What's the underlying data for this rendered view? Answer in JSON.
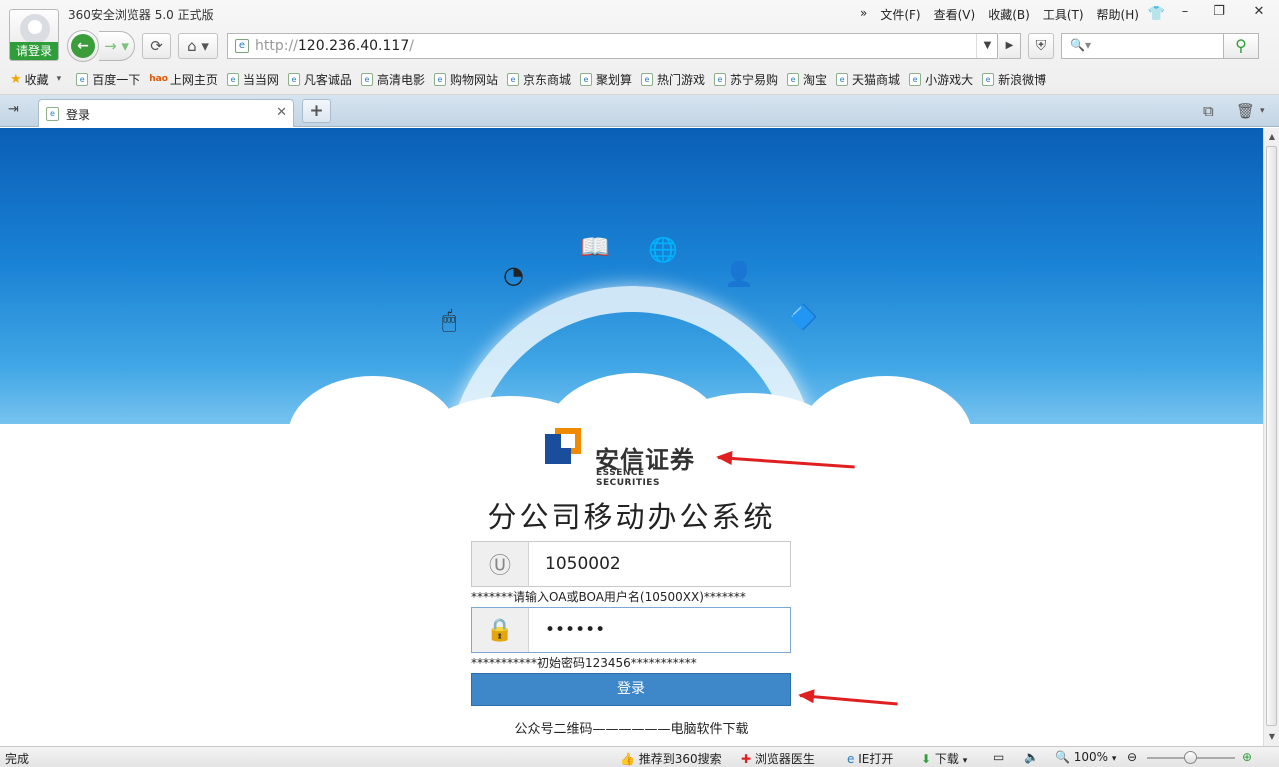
{
  "browser": {
    "title": "360安全浏览器 5.0 正式版",
    "login_label": "请登录",
    "menus": [
      "文件(F)",
      "查看(V)",
      "收藏(B)",
      "工具(T)",
      "帮助(H)"
    ],
    "menu_more": "»",
    "url_scheme": "http://",
    "url_host": "120.236.40.117",
    "url_path": "/",
    "search_placeholder": "",
    "favorites_label": "收藏",
    "bookmarks": [
      "百度一下",
      "上网主页",
      "当当网",
      "凡客诚品",
      "高清电影",
      "购物网站",
      "京东商城",
      "聚划算",
      "热门游戏",
      "苏宁易购",
      "淘宝",
      "天猫商城",
      "小游戏大",
      "新浪微博"
    ],
    "hao_label": "hao",
    "tab_title": "登录"
  },
  "page": {
    "logo_cn": "安信证券",
    "logo_en": "ESSENCE SECURITIES",
    "system_title": "分公司移动办公系统",
    "username_value": "1050002",
    "username_hint": "*******请输入OA或BOA用户名(10500XX)*******",
    "password_value": "••••••",
    "password_hint": "***********初始密码123456***********",
    "login_button": "登录",
    "footer_left": "公众号二维码",
    "footer_sep": "——————",
    "footer_right": "电脑软件下载"
  },
  "status": {
    "done": "完成",
    "recommend": "推荐到360搜索",
    "doctor": "浏览器医生",
    "ie_open": "IE打开",
    "download": "下载",
    "zoom": "100%"
  },
  "colors": {
    "banner_top": "#0a5fb6",
    "login_button": "#3e87c8",
    "logo_orange": "#f08a00",
    "logo_blue": "#1a4e9c",
    "arrow": "#e02020"
  }
}
